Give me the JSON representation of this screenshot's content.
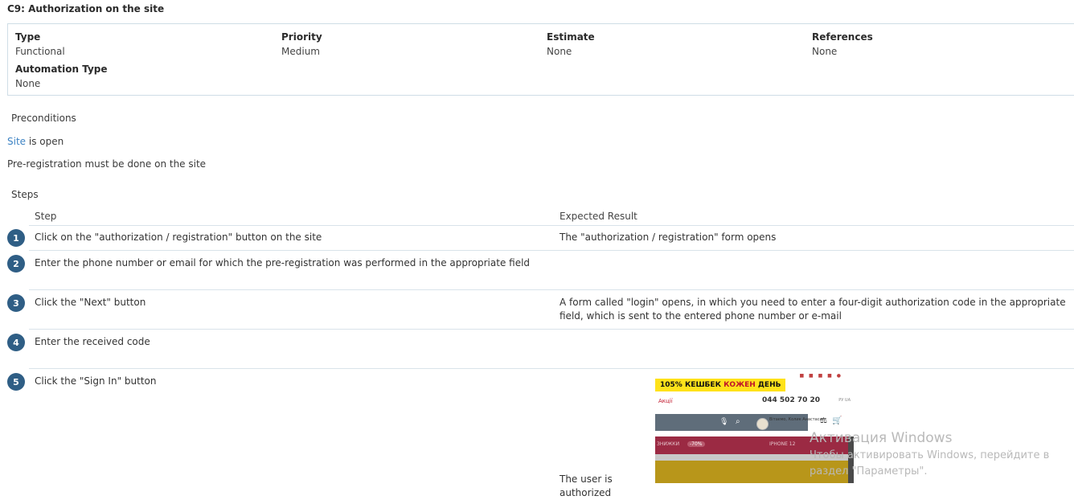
{
  "case_title": "C9: Authorization on the site",
  "properties": {
    "type": {
      "label": "Type",
      "value": "Functional"
    },
    "priority": {
      "label": "Priority",
      "value": "Medium"
    },
    "estimate": {
      "label": "Estimate",
      "value": "None"
    },
    "references": {
      "label": "References",
      "value": "None"
    },
    "automation_type": {
      "label": "Automation Type",
      "value": "None"
    }
  },
  "preconditions": {
    "title": "Preconditions",
    "line1_link": "Site",
    "line1_rest": " is open",
    "line2": "Pre-registration must be done on the site"
  },
  "steps": {
    "title": "Steps",
    "col_step": "Step",
    "col_expected": "Expected Result",
    "rows": [
      {
        "num": "1",
        "step": "Click on the \"authorization / registration\" button on the site",
        "expected": "The \"authorization / registration\" form opens"
      },
      {
        "num": "2",
        "step": "Enter the phone number or email for which the pre-registration was performed in the appropriate field",
        "expected": ""
      },
      {
        "num": "3",
        "step": "Click the \"Next\" button",
        "expected": "A form called \"login\" opens, in which you need to enter a four-digit authorization code in the appropriate field, which is sent to the entered phone number or e-mail"
      },
      {
        "num": "4",
        "step": "Enter the received code",
        "expected": ""
      },
      {
        "num": "5",
        "step": "Click the \"Sign In\" button",
        "expected": "The user is authorized"
      }
    ]
  },
  "attachment": {
    "promo_a": "105% КЕШБЕК ",
    "promo_b": "КОЖЕН",
    "promo_c": " ДЕНЬ",
    "left_link": "Акції",
    "phone": "044 502 70 20",
    "lang": "РУ  UA",
    "user_name": "Вітаємо, Колик Анастасия",
    "badge": "-70%",
    "badge_label": "ЗНИЖКИ",
    "product": "IPHONE 12"
  },
  "watermark": {
    "line1": "Активация Windows",
    "line2": "Чтобы активировать Windows, перейдите в",
    "line3": "раздел \"Параметры\"."
  }
}
